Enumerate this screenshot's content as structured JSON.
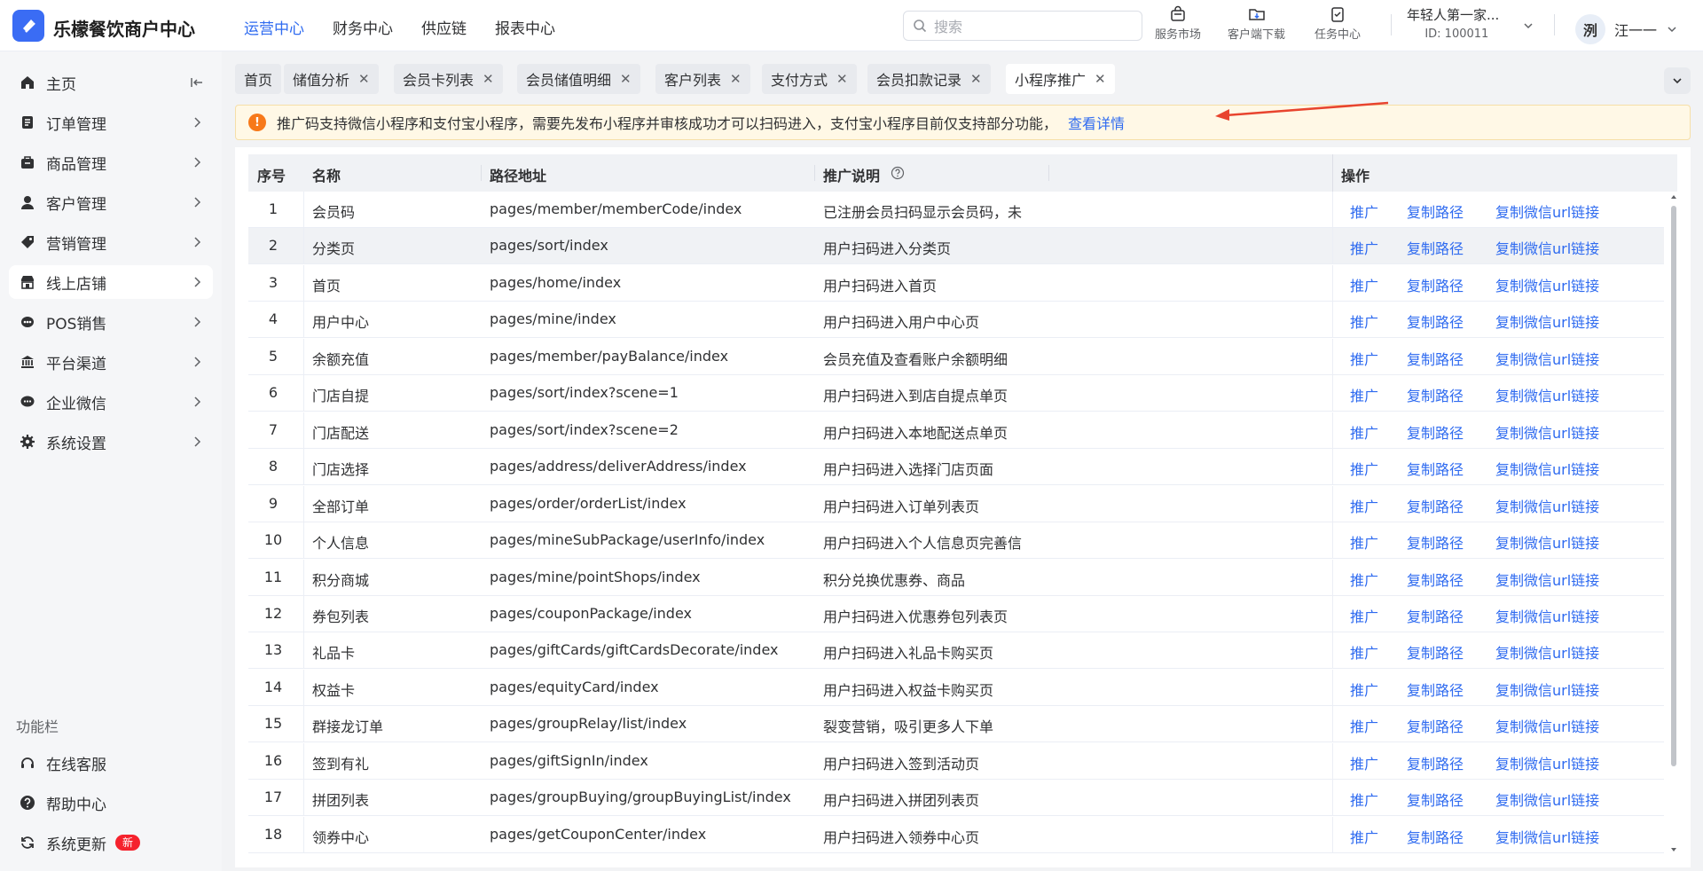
{
  "app": {
    "brand": "乐檬餐饮商户中心",
    "logo_icon": "brand-logo-icon"
  },
  "topnav": [
    {
      "label": "运营中心",
      "active": true
    },
    {
      "label": "财务中心",
      "active": false
    },
    {
      "label": "供应链",
      "active": false
    },
    {
      "label": "报表中心",
      "active": false
    }
  ],
  "search": {
    "placeholder": "搜索",
    "value": ""
  },
  "tools": [
    {
      "label": "服务市场",
      "icon": "shopping-bag-icon"
    },
    {
      "label": "客户端下载",
      "icon": "folder-download-icon"
    },
    {
      "label": "任务中心",
      "icon": "clipboard-check-icon"
    }
  ],
  "shop": {
    "name": "年轻人第一家...",
    "id": "ID: 100011"
  },
  "user": {
    "name": "汪一一",
    "avatar_text": "洌"
  },
  "sidebar": {
    "items": [
      {
        "label": "主页",
        "icon": "home-icon",
        "active": false
      },
      {
        "label": "订单管理",
        "icon": "order-icon",
        "active": false
      },
      {
        "label": "商品管理",
        "icon": "product-icon",
        "active": false
      },
      {
        "label": "客户管理",
        "icon": "customer-icon",
        "active": false
      },
      {
        "label": "营销管理",
        "icon": "tag-icon",
        "active": false
      },
      {
        "label": "线上店铺",
        "icon": "store-icon",
        "active": true
      },
      {
        "label": "POS销售",
        "icon": "pos-icon",
        "active": false
      },
      {
        "label": "平台渠道",
        "icon": "bank-icon",
        "active": false
      },
      {
        "label": "企业微信",
        "icon": "chat-icon",
        "active": false
      },
      {
        "label": "系统设置",
        "icon": "gear-icon",
        "active": false
      }
    ],
    "section_title": "功能栏",
    "footer_items": [
      {
        "label": "在线客服",
        "icon": "headset-icon"
      },
      {
        "label": "帮助中心",
        "icon": "help-icon"
      },
      {
        "label": "系统更新",
        "icon": "refresh-icon",
        "badge": "新"
      }
    ]
  },
  "tabs": [
    {
      "label": "首页",
      "closable": false,
      "active": false
    },
    {
      "label": "储值分析",
      "closable": true,
      "active": false
    },
    {
      "label": "会员卡列表",
      "closable": true,
      "active": false
    },
    {
      "label": "会员储值明细",
      "closable": true,
      "active": false
    },
    {
      "label": "客户列表",
      "closable": true,
      "active": false
    },
    {
      "label": "支付方式",
      "closable": true,
      "active": false
    },
    {
      "label": "会员扣款记录",
      "closable": true,
      "active": false
    },
    {
      "label": "小程序推广",
      "closable": true,
      "active": true
    }
  ],
  "notice": {
    "text": "推广码支持微信小程序和支付宝小程序，需要先发布小程序并审核成功才可以扫码进入，支付宝小程序目前仅支持部分功能，",
    "link": "查看详情",
    "arrow_color": "#e8442e"
  },
  "table": {
    "headers": {
      "index": "序号",
      "name": "名称",
      "path": "路径地址",
      "desc": "推广说明",
      "ops": "操作"
    },
    "actions": {
      "promote": "推广",
      "copy_path": "复制路径",
      "copy_url": "复制微信url链接"
    },
    "rows": [
      {
        "index": "1",
        "name": "会员码",
        "path": "pages/member/memberCode/index",
        "desc": "已注册会员扫码显示会员码，未"
      },
      {
        "index": "2",
        "name": "分类页",
        "path": "pages/sort/index",
        "desc": "用户扫码进入分类页"
      },
      {
        "index": "3",
        "name": "首页",
        "path": "pages/home/index",
        "desc": "用户扫码进入首页"
      },
      {
        "index": "4",
        "name": "用户中心",
        "path": "pages/mine/index",
        "desc": "用户扫码进入用户中心页"
      },
      {
        "index": "5",
        "name": "余额充值",
        "path": "pages/member/payBalance/index",
        "desc": "会员充值及查看账户余额明细"
      },
      {
        "index": "6",
        "name": "门店自提",
        "path": "pages/sort/index?scene=1",
        "desc": "用户扫码进入到店自提点单页"
      },
      {
        "index": "7",
        "name": "门店配送",
        "path": "pages/sort/index?scene=2",
        "desc": "用户扫码进入本地配送点单页"
      },
      {
        "index": "8",
        "name": "门店选择",
        "path": "pages/address/deliverAddress/index",
        "desc": "用户扫码进入选择门店页面"
      },
      {
        "index": "9",
        "name": "全部订单",
        "path": "pages/order/orderList/index",
        "desc": "用户扫码进入订单列表页"
      },
      {
        "index": "10",
        "name": "个人信息",
        "path": "pages/mineSubPackage/userInfo/index",
        "desc": "用户扫码进入个人信息页完善信"
      },
      {
        "index": "11",
        "name": "积分商城",
        "path": "pages/mine/pointShops/index",
        "desc": "积分兑换优惠券、商品"
      },
      {
        "index": "12",
        "name": "券包列表",
        "path": "pages/couponPackage/index",
        "desc": "用户扫码进入优惠券包列表页"
      },
      {
        "index": "13",
        "name": "礼品卡",
        "path": "pages/giftCards/giftCardsDecorate/index",
        "desc": "用户扫码进入礼品卡购买页"
      },
      {
        "index": "14",
        "name": "权益卡",
        "path": "pages/equityCard/index",
        "desc": "用户扫码进入权益卡购买页"
      },
      {
        "index": "15",
        "name": "群接龙订单",
        "path": "pages/groupRelay/list/index",
        "desc": "裂变营销，吸引更多人下单"
      },
      {
        "index": "16",
        "name": "签到有礼",
        "path": "pages/giftSignIn/index",
        "desc": "用户扫码进入签到活动页"
      },
      {
        "index": "17",
        "name": "拼团列表",
        "path": "pages/groupBuying/groupBuyingList/index",
        "desc": "用户扫码进入拼团列表页"
      },
      {
        "index": "18",
        "name": "领券中心",
        "path": "pages/getCouponCenter/index",
        "desc": "用户扫码进入领券中心页"
      }
    ],
    "highlighted_row": "2"
  }
}
